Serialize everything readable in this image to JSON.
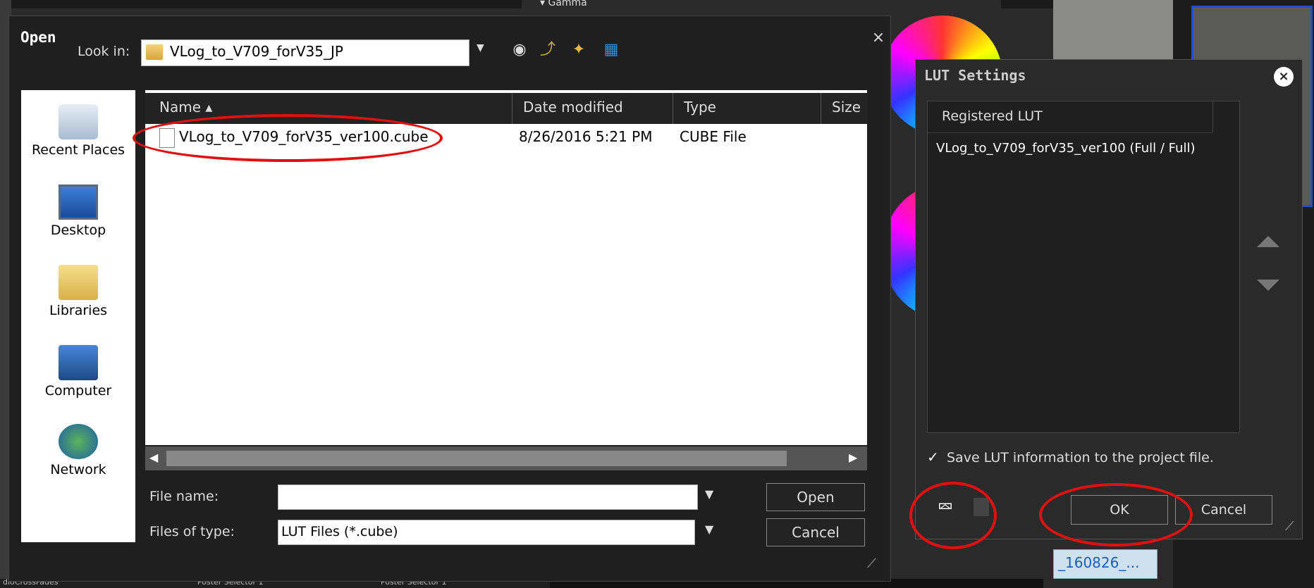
{
  "background": {
    "gamma_label": "▾ Gamma",
    "thumb_label": "_160826_...",
    "bottom_labels": [
      "dioCrossFades",
      "Poster Selector 1",
      "Poster Selector 1"
    ]
  },
  "open_dialog": {
    "title": "Open",
    "close_icon": "×",
    "look_in_label": "Look in:",
    "look_in_value": "VLog_to_V709_forV35_JP",
    "places": [
      "Recent Places",
      "Desktop",
      "Libraries",
      "Computer",
      "Network"
    ],
    "columns": {
      "name": "Name ▴",
      "date": "Date modified",
      "type": "Type",
      "size": "Size"
    },
    "file": {
      "name": "VLog_to_V709_forV35_ver100.cube",
      "date": "8/26/2016 5:21 PM",
      "type": "CUBE File"
    },
    "file_name_label": "File name:",
    "file_name_value": "",
    "files_of_type_label": "Files of type:",
    "files_of_type_value": "LUT Files (*.cube)",
    "open_button": "Open",
    "cancel_button": "Cancel"
  },
  "lut_settings": {
    "title": "LUT Settings",
    "list_header": "Registered LUT",
    "entries": [
      "VLog_to_V709_forV35_ver100 (Full / Full)"
    ],
    "save_checkbox_label": "Save LUT information to the project file.",
    "save_checked": true,
    "ok_button": "OK",
    "cancel_button": "Cancel"
  },
  "colors": {
    "annotation": "#e01010",
    "dialog_bg": "#1f1f1f"
  }
}
